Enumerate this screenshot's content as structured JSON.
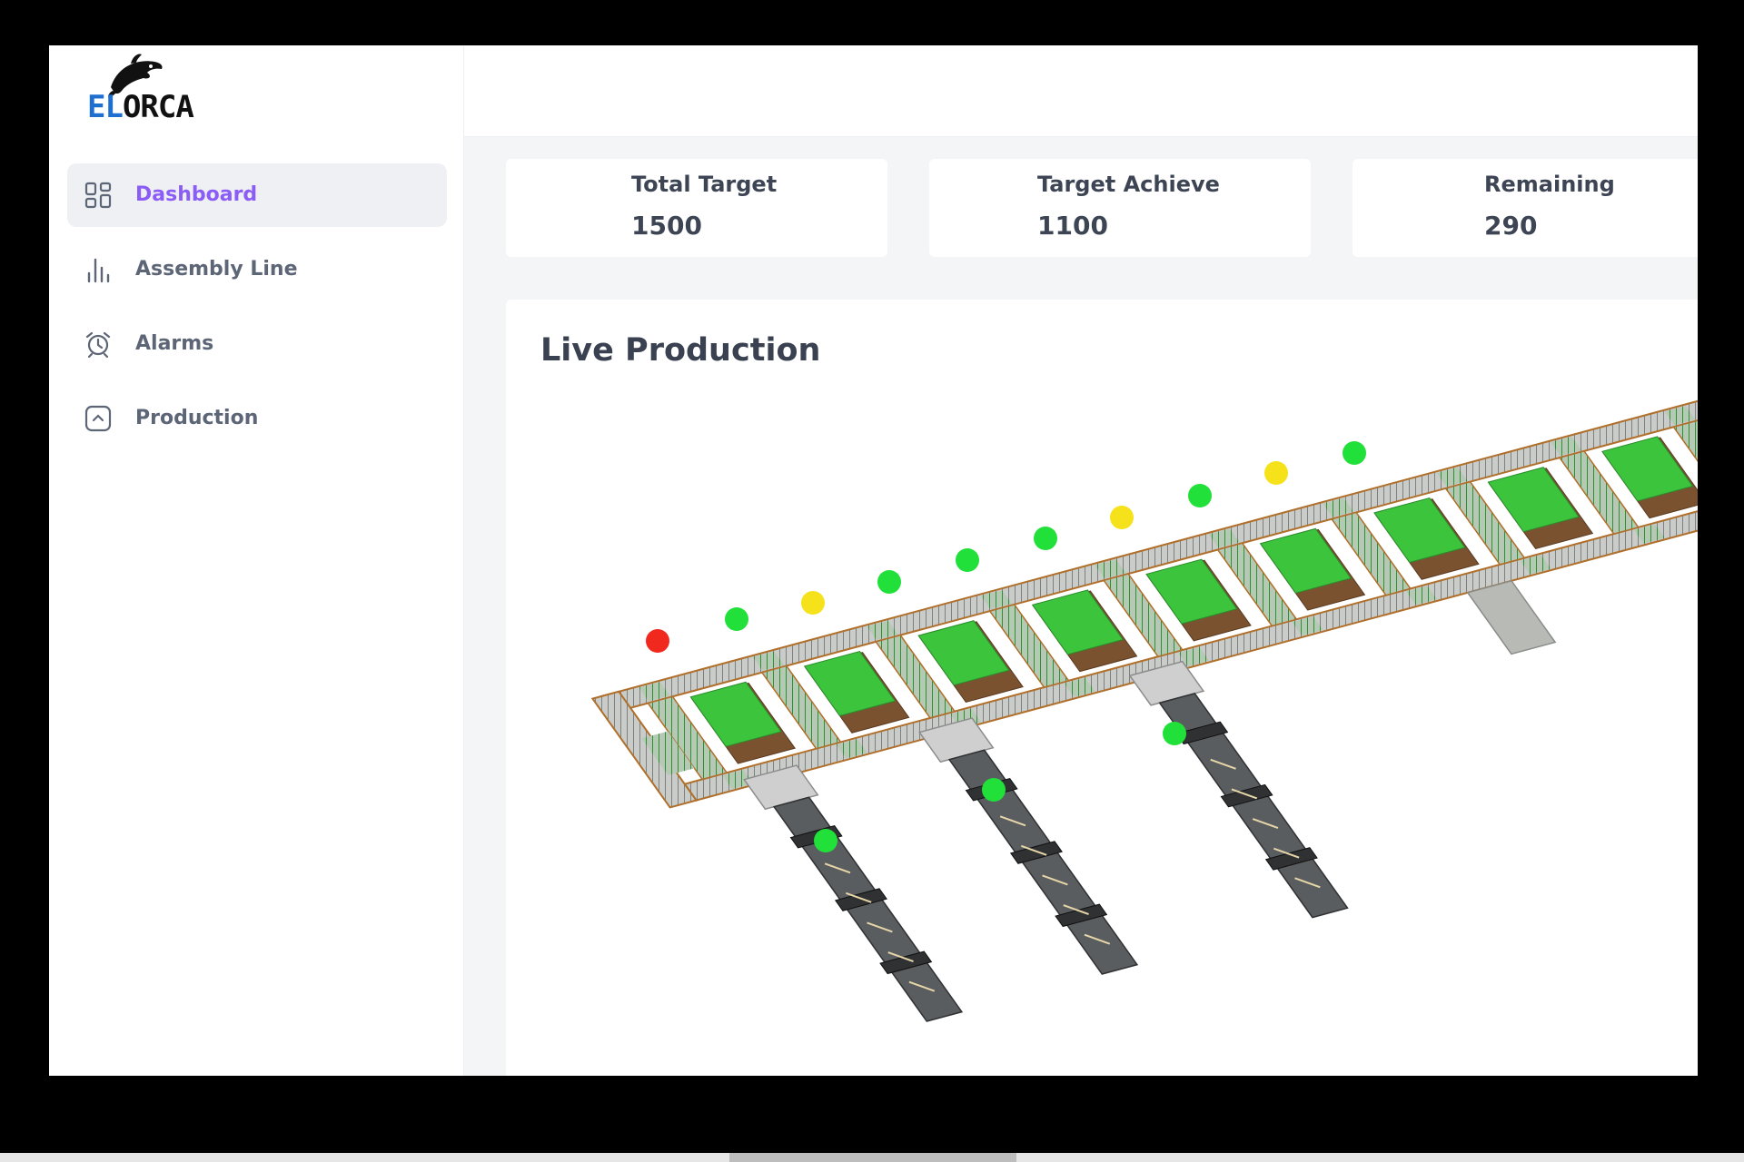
{
  "brand": {
    "name_accent": "EL",
    "name_rest": "ORCA",
    "logo_icon": "orca-icon"
  },
  "sidebar": {
    "items": [
      {
        "label": "Dashboard",
        "icon": "grid-icon",
        "active": true
      },
      {
        "label": "Assembly Line",
        "icon": "bar-chart-icon",
        "active": false
      },
      {
        "label": "Alarms",
        "icon": "alarm-clock-icon",
        "active": false
      },
      {
        "label": "Production",
        "icon": "chevron-up-square-icon",
        "active": false
      }
    ]
  },
  "stats": [
    {
      "label": "Total Target",
      "value": "1500"
    },
    {
      "label": "Target Achieve",
      "value": "1100"
    },
    {
      "label": "Remaining",
      "value": "290"
    }
  ],
  "live_production": {
    "title": "Live Production",
    "station_status": [
      "red",
      "green",
      "yellow",
      "green",
      "green",
      "green",
      "yellow",
      "green",
      "yellow",
      "green",
      "green",
      "green",
      "green"
    ]
  },
  "colors": {
    "accent": "#8b5cf6",
    "status_green": "#22e03a",
    "status_yellow": "#f6e21a",
    "status_red": "#f0281e",
    "pallet_green": "#3cc43c"
  }
}
